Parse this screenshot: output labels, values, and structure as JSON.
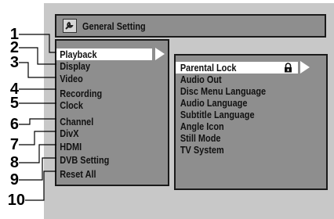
{
  "title_bar": {
    "title": "General Setting",
    "icon": "wrench-icon"
  },
  "main_menu": {
    "items": [
      {
        "label": "Playback",
        "selected": true
      },
      {
        "label": "Display"
      },
      {
        "label": "Video"
      },
      {
        "label": "Recording"
      },
      {
        "label": "Clock"
      },
      {
        "label": "Channel"
      },
      {
        "label": "DivX"
      },
      {
        "label": "HDMI"
      },
      {
        "label": "DVB Setting"
      },
      {
        "label": "Reset All"
      }
    ]
  },
  "sub_menu": {
    "items": [
      {
        "label": "Parental Lock",
        "selected": true,
        "icon": "lock-icon"
      },
      {
        "label": "Audio Out"
      },
      {
        "label": "Disc Menu Language"
      },
      {
        "label": "Audio Language"
      },
      {
        "label": "Subtitle Language"
      },
      {
        "label": "Angle Icon"
      },
      {
        "label": "Still Mode"
      },
      {
        "label": "TV System"
      }
    ]
  },
  "callouts": [
    "1",
    "2",
    "3",
    "4",
    "5",
    "6",
    "7",
    "8",
    "9",
    "10"
  ],
  "colors": {
    "panel": "#8e8e8e",
    "screen": "#c8c8c8",
    "highlight": "#ffffff",
    "border": "#1a1a1a"
  }
}
